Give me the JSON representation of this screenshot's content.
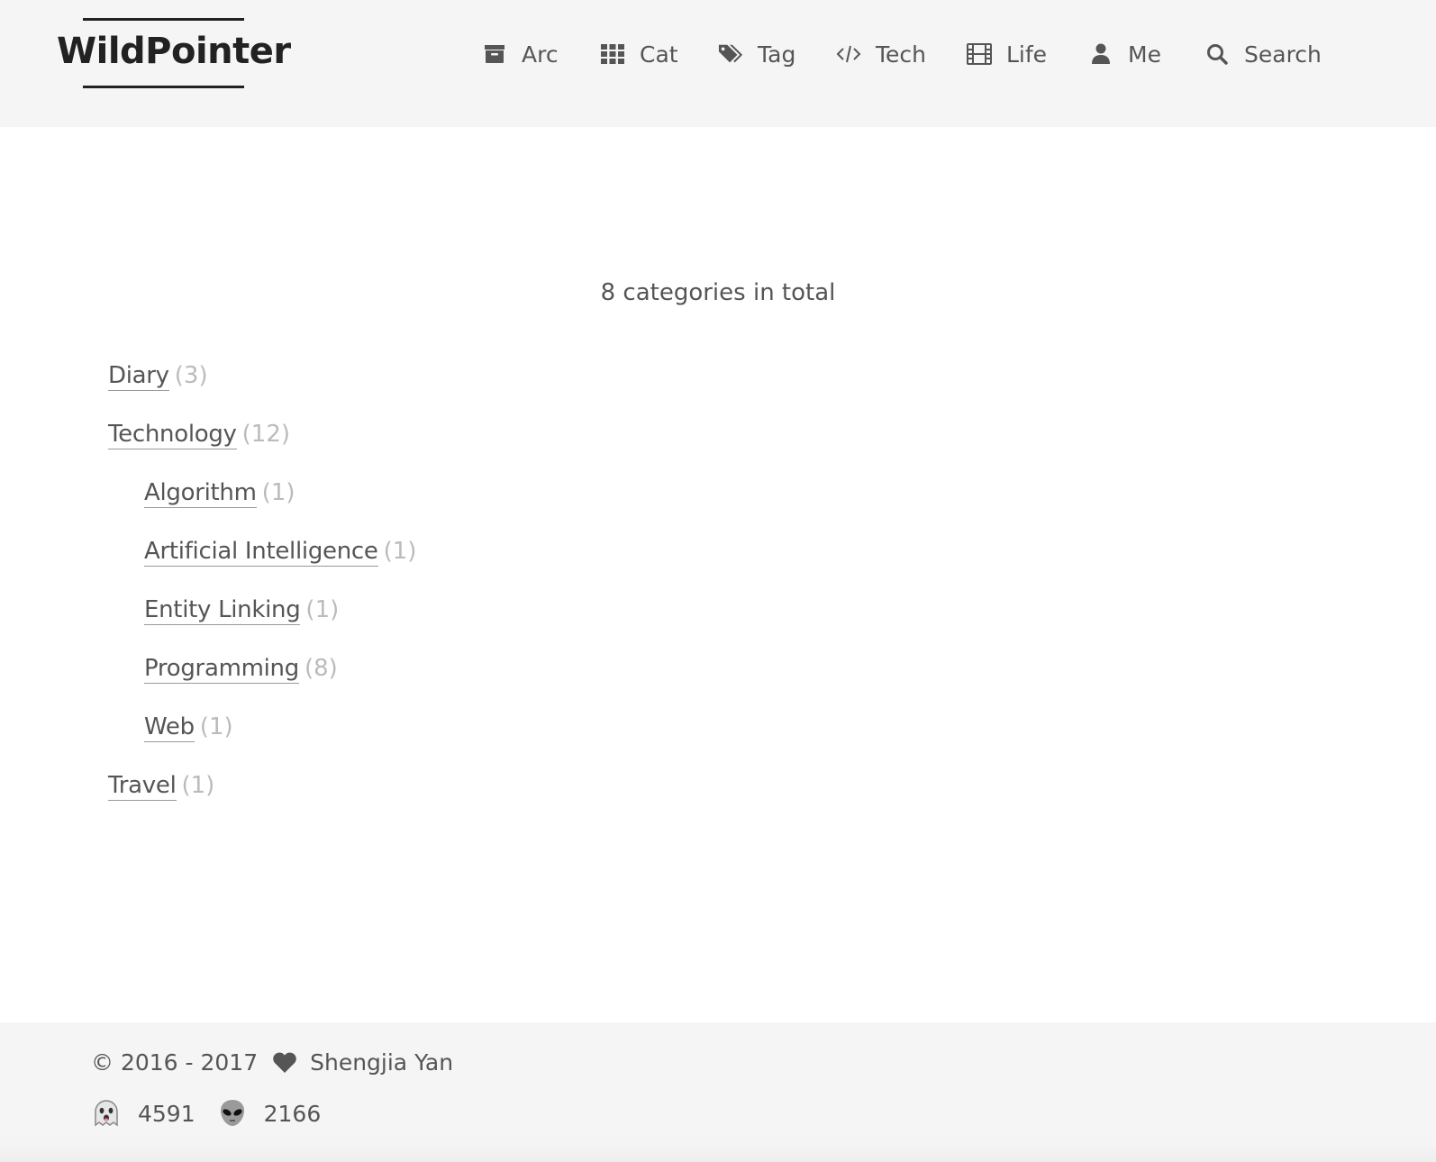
{
  "brand": {
    "title": "WildPointer"
  },
  "nav": {
    "items": [
      {
        "label": "Arc",
        "icon": "archive-icon"
      },
      {
        "label": "Cat",
        "icon": "grid-icon"
      },
      {
        "label": "Tag",
        "icon": "tags-icon"
      },
      {
        "label": "Tech",
        "icon": "code-icon"
      },
      {
        "label": "Life",
        "icon": "film-icon"
      },
      {
        "label": "Me",
        "icon": "user-icon"
      },
      {
        "label": "Search",
        "icon": "search-icon"
      }
    ]
  },
  "main": {
    "title": "8 categories in total",
    "categories": [
      {
        "name": "Diary",
        "count": "(3)",
        "level": 0
      },
      {
        "name": "Technology",
        "count": "(12)",
        "level": 0
      },
      {
        "name": "Algorithm",
        "count": "(1)",
        "level": 1
      },
      {
        "name": "Artificial Intelligence",
        "count": "(1)",
        "level": 1
      },
      {
        "name": "Entity Linking",
        "count": "(1)",
        "level": 1
      },
      {
        "name": "Programming",
        "count": "(8)",
        "level": 1
      },
      {
        "name": "Web",
        "count": "(1)",
        "level": 1
      },
      {
        "name": "Travel",
        "count": "(1)",
        "level": 0
      }
    ]
  },
  "footer": {
    "copyright": "© 2016 - 2017",
    "author": "Shengjia Yan",
    "visitors": "4591",
    "views": "2166",
    "visitors_icon": "ghost-icon",
    "views_icon": "alien-icon"
  },
  "colors": {
    "header_bg": "#f5f5f5",
    "text": "#555555",
    "brand": "#222222",
    "count": "#bbbbbb"
  }
}
